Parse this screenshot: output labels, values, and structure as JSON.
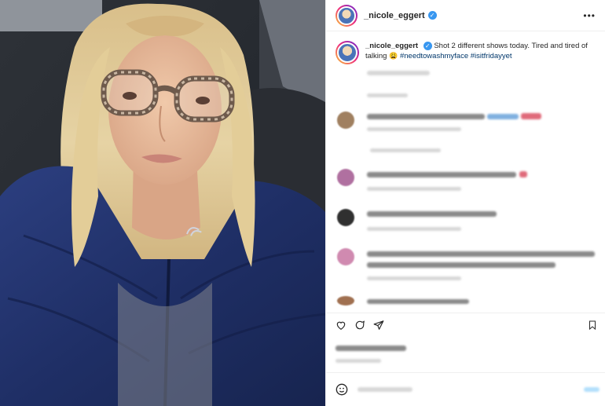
{
  "post": {
    "username": "_nicole_eggert",
    "verified_mark": "✓",
    "more": "•••"
  },
  "caption": {
    "username": "_nicole_eggert",
    "text_1": "Shot 2 different shows today. Tired and tired of talking",
    "emoji": "😩",
    "hashtag_1": "#needtowashmyface",
    "hashtag_2": "#isitfridayyet"
  },
  "icons": {
    "like": "heart-icon",
    "comment": "comment-icon",
    "share": "share-icon",
    "save": "bookmark-icon",
    "emoji": "smiley-icon"
  },
  "colors": {
    "hashtag": "#00376b",
    "verified": "#3897f0",
    "story_ring": "#ee2a7b"
  }
}
